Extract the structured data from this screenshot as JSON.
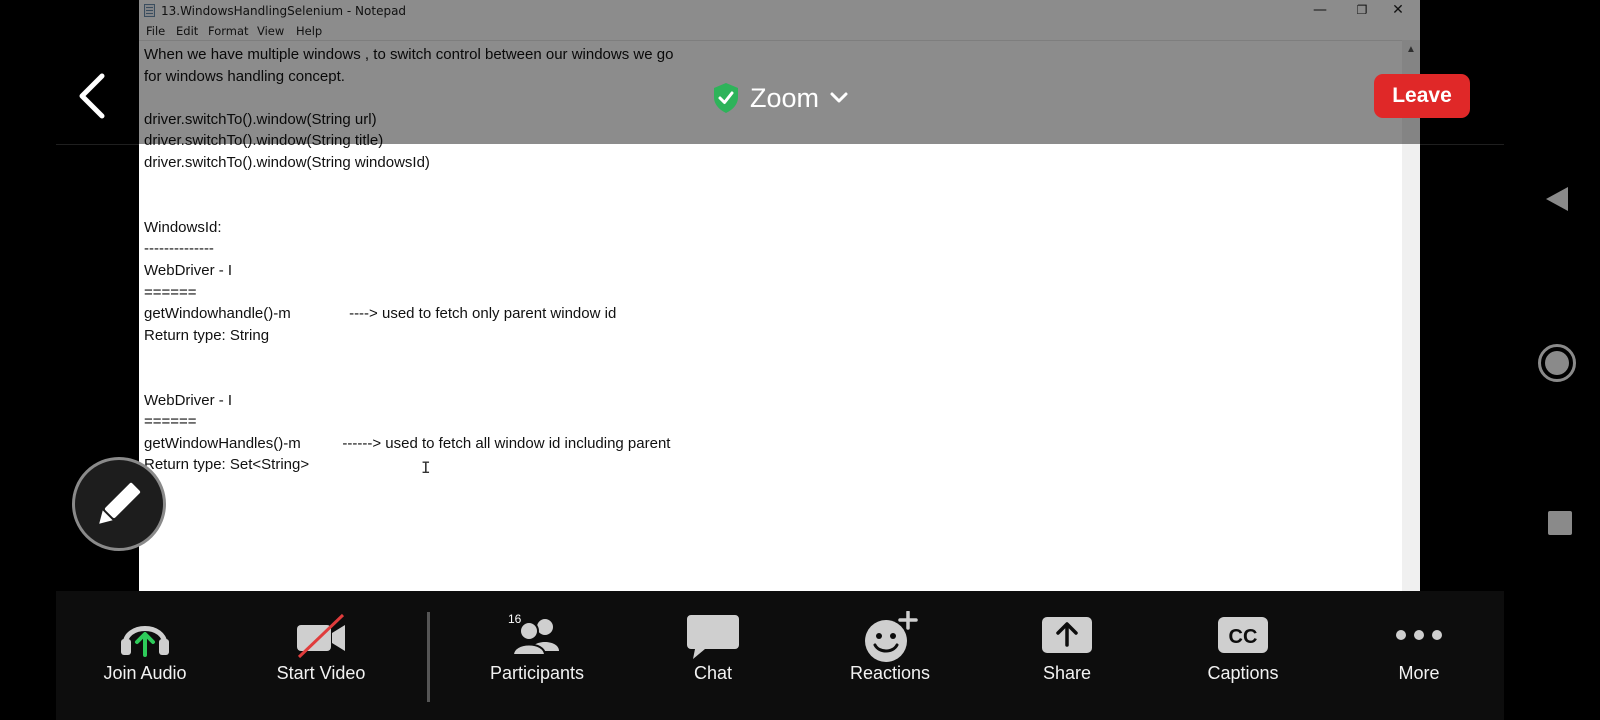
{
  "notepad": {
    "title": "13.WindowsHandlingSelenium - Notepad",
    "menu": [
      "File",
      "Edit",
      "Format",
      "View",
      "Help"
    ],
    "controls": {
      "minimize": "—",
      "restore": "❐",
      "close": "✕"
    },
    "content": "When we have multiple windows , to switch control between our windows we go\nfor windows handling concept.\n\ndriver.switchTo().window(String url)\ndriver.switchTo().window(String title)\ndriver.switchTo().window(String windowsId)\n\n\nWindowsId:\n--------------\nWebDriver - I\n======\ngetWindowhandle()-m              ----> used to fetch only parent window id\nReturn type: String\n\n\nWebDriver - I\n======\ngetWindowHandles()-m          ------> used to fetch all window id including parent\nReturn type: Set<String>"
  },
  "zoom": {
    "meeting_title": "Zoom",
    "leave_label": "Leave",
    "shield_color": "#2eb35a",
    "leave_color": "#e02828"
  },
  "toolbar": {
    "items": [
      {
        "label": "Join Audio",
        "icon": "headphones-icon"
      },
      {
        "label": "Start Video",
        "icon": "video-off-icon"
      },
      {
        "label": "Participants",
        "icon": "participants-icon",
        "badge": "16"
      },
      {
        "label": "Chat",
        "icon": "chat-icon"
      },
      {
        "label": "Reactions",
        "icon": "reactions-icon"
      },
      {
        "label": "Share",
        "icon": "share-icon"
      },
      {
        "label": "Captions",
        "icon": "captions-icon",
        "icon_text": "CC"
      },
      {
        "label": "More",
        "icon": "more-icon"
      }
    ]
  }
}
